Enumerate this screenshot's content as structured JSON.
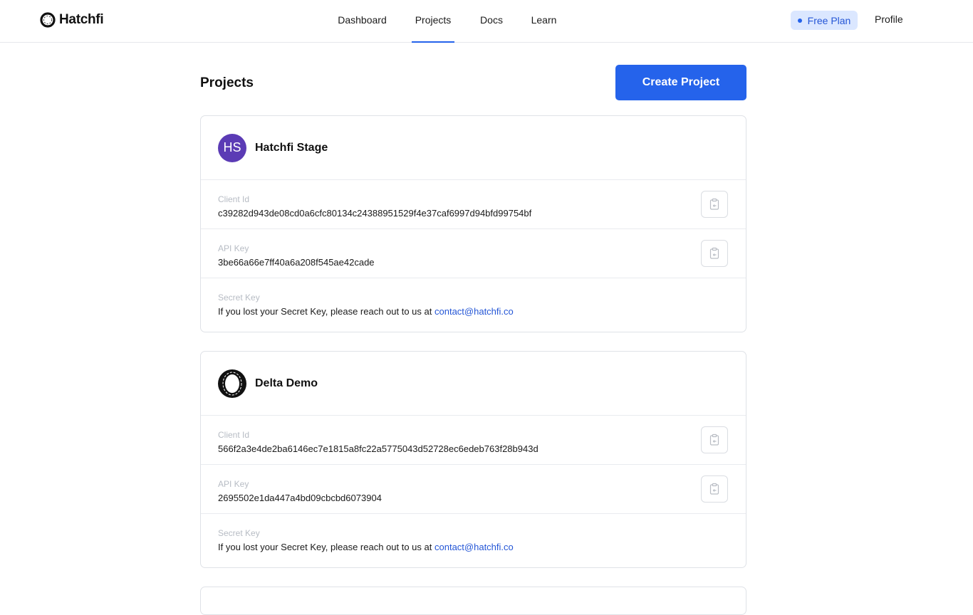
{
  "brand": {
    "name": "Hatchfi",
    "logo_icon": "ring-logo-icon"
  },
  "nav": {
    "items": [
      {
        "label": "Dashboard",
        "active": false
      },
      {
        "label": "Projects",
        "active": true
      },
      {
        "label": "Docs",
        "active": false
      },
      {
        "label": "Learn",
        "active": false
      }
    ],
    "plan_badge": "Free Plan",
    "profile": "Profile"
  },
  "page": {
    "title": "Projects",
    "create_button": "Create Project"
  },
  "projects": [
    {
      "name": "Hatchfi Stage",
      "avatar_initials": "HS",
      "avatar_color": "#5b3bb5",
      "client_id_label": "Client Id",
      "client_id": "c39282d943de08cd0a6cfc80134c24388951529f4e37caf6997d94bfd99754bf",
      "api_key_label": "API Key",
      "api_key": "3be66a66e7ff40a6a208f545ae42cade",
      "secret_key_label": "Secret Key",
      "secret_key_text": "If you lost your Secret Key, please reach out to us at",
      "contact_email": "contact@hatchfi.co"
    },
    {
      "name": "Delta Demo",
      "avatar_icon": "ring-logo-icon",
      "client_id_label": "Client Id",
      "client_id": "566f2a3e4de2ba6146ec7e1815a8fc22a5775043d52728ec6edeb763f28b943d",
      "api_key_label": "API Key",
      "api_key": "2695502e1da447a4bd09cbcbd6073904",
      "secret_key_label": "Secret Key",
      "secret_key_text": "If you lost your Secret Key, please reach out to us at",
      "contact_email": "contact@hatchfi.co"
    }
  ],
  "colors": {
    "accent": "#2563eb",
    "badge_bg": "#dbe7ff",
    "link": "#2456d6"
  }
}
